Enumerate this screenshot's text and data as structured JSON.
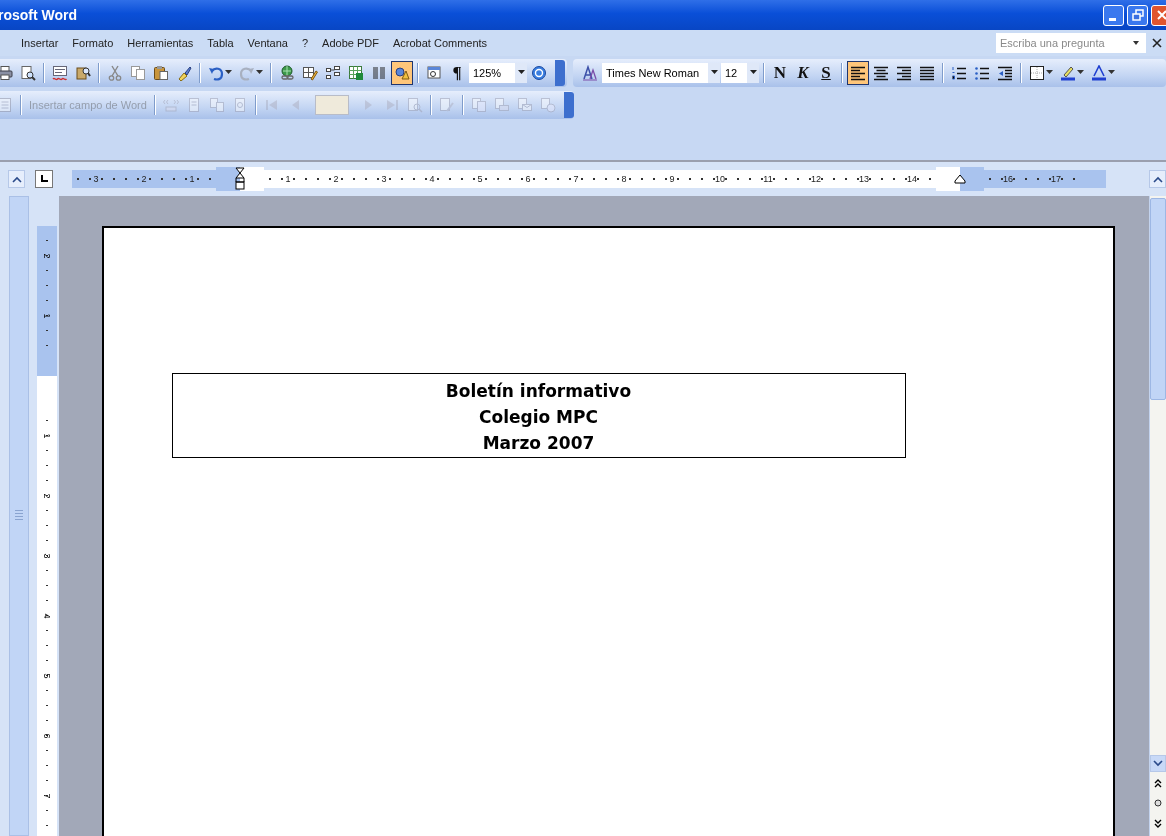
{
  "window": {
    "title": "rosoft Word"
  },
  "menu": [
    {
      "label": "Insertar"
    },
    {
      "label": "Formato"
    },
    {
      "label": "Herramientas"
    },
    {
      "label": "Tabla"
    },
    {
      "label": "Ventana"
    },
    {
      "label": "?"
    },
    {
      "label": "Adobe PDF"
    },
    {
      "label": "Acrobat Comments"
    }
  ],
  "help_box": {
    "placeholder": "Escriba una pregunta"
  },
  "standard_toolbar": {
    "buttons": [
      {
        "kind": "print",
        "selected": false
      },
      {
        "kind": "preview",
        "selected": false
      },
      {
        "kind": "sep"
      },
      {
        "kind": "spelling",
        "selected": false
      },
      {
        "kind": "research",
        "selected": false
      },
      {
        "kind": "sep"
      },
      {
        "kind": "cut",
        "selected": false
      },
      {
        "kind": "copy",
        "selected": false
      },
      {
        "kind": "paste",
        "selected": false
      },
      {
        "kind": "brush",
        "selected": false
      },
      {
        "kind": "sep"
      },
      {
        "kind": "undo",
        "selected": false
      },
      {
        "kind": "redo",
        "selected": false
      },
      {
        "kind": "sep"
      },
      {
        "kind": "hyperlink",
        "selected": false
      },
      {
        "kind": "tableborders",
        "selected": false
      },
      {
        "kind": "inserttable",
        "selected": false
      },
      {
        "kind": "excel",
        "selected": false
      },
      {
        "kind": "columns",
        "selected": false
      },
      {
        "kind": "drawing",
        "selected": true
      },
      {
        "kind": "sep"
      },
      {
        "kind": "docmap",
        "selected": false
      },
      {
        "kind": "pilcrow",
        "label": "¶",
        "selected": false
      }
    ],
    "zoom": "125%"
  },
  "formatting_toolbar": {
    "font": "Times New Roman",
    "size": "12",
    "text_buttons": [
      {
        "label": "N",
        "kind": "bold"
      },
      {
        "label": "K",
        "kind": "italic"
      },
      {
        "label": "S",
        "kind": "underline"
      }
    ],
    "buttons": [
      {
        "kind": "alignleft",
        "selected": true
      },
      {
        "kind": "aligncenter",
        "selected": false
      },
      {
        "kind": "alignright",
        "selected": false
      },
      {
        "kind": "justify",
        "selected": false
      },
      {
        "kind": "sep"
      },
      {
        "kind": "numbering",
        "selected": false
      },
      {
        "kind": "bullets",
        "selected": false
      },
      {
        "kind": "outdent",
        "selected": false
      },
      {
        "kind": "sep"
      },
      {
        "kind": "border",
        "selected": false
      },
      {
        "kind": "highlight",
        "selected": false
      },
      {
        "kind": "fontcolor",
        "selected": false
      }
    ]
  },
  "mail_merge_toolbar": {
    "field_label": "Insertar campo de Word",
    "disabled": true,
    "buttons_before": [
      {
        "kind": "mergefield"
      },
      {
        "kind": "page"
      },
      {
        "kind": "pages"
      },
      {
        "kind": "refresh"
      },
      {
        "kind": "sep"
      },
      {
        "kind": "first"
      },
      {
        "kind": "prev"
      }
    ],
    "buttons_after": [
      {
        "kind": "next"
      },
      {
        "kind": "last"
      },
      {
        "kind": "find"
      },
      {
        "kind": "sep"
      },
      {
        "kind": "edit"
      },
      {
        "kind": "sep"
      },
      {
        "kind": "merge1"
      },
      {
        "kind": "merge2"
      },
      {
        "kind": "merge3"
      },
      {
        "kind": "merge4"
      }
    ]
  },
  "horizontal_ruler": {
    "left_labels": [
      "3",
      "2",
      "1"
    ],
    "labels": [
      "1",
      "2",
      "3",
      "4",
      "5",
      "6",
      "7",
      "8",
      "9",
      "10",
      "11",
      "12",
      "13",
      "14"
    ],
    "right_labels": [
      "16",
      "17"
    ]
  },
  "vertical_ruler": {
    "top_labels": [
      "2",
      "1"
    ],
    "labels": [
      "1",
      "2",
      "3",
      "4",
      "5",
      "6",
      "7"
    ]
  },
  "document": {
    "heading_lines": [
      "Boletín informativo",
      "Colegio MPC",
      "Marzo 2007"
    ]
  }
}
